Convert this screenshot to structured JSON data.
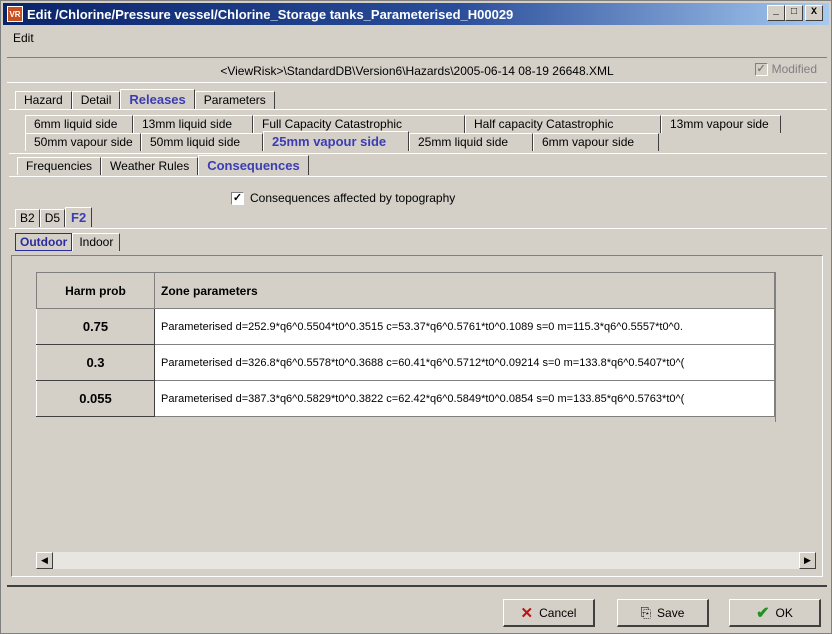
{
  "window": {
    "icon_text": "VR",
    "title": "Edit /Chlorine/Pressure vessel/Chlorine_Storage tanks_Parameterised_H00029",
    "min_glyph": "_",
    "max_glyph": "□",
    "close_glyph": "X"
  },
  "menu": {
    "edit_label": "Edit"
  },
  "pathbar": {
    "path": "<ViewRisk>\\StandardDB\\Version6\\Hazards\\2005-06-14 08-19 26648.XML",
    "modified_label": "Modified",
    "modified_checked_glyph": "✓"
  },
  "tabs_main": [
    {
      "label": "Hazard"
    },
    {
      "label": "Detail"
    },
    {
      "label": "Releases"
    },
    {
      "label": "Parameters"
    }
  ],
  "release_tabs_row1": [
    {
      "label": "6mm liquid side"
    },
    {
      "label": "13mm liquid side"
    },
    {
      "label": "Full Capacity Catastrophic"
    },
    {
      "label": "Half capacity Catastrophic"
    },
    {
      "label": "13mm vapour side"
    }
  ],
  "release_tabs_row2": [
    {
      "label": "50mm vapour side"
    },
    {
      "label": "50mm liquid side"
    },
    {
      "label": "25mm vapour side"
    },
    {
      "label": "25mm liquid side"
    },
    {
      "label": "6mm vapour side"
    }
  ],
  "sub_tabs": [
    {
      "label": "Frequencies"
    },
    {
      "label": "Weather Rules"
    },
    {
      "label": "Consequences"
    }
  ],
  "topography": {
    "label": "Consequences affected by topography",
    "checked_glyph": "✓"
  },
  "weather_tabs": [
    {
      "label": "B2"
    },
    {
      "label": "D5"
    },
    {
      "label": "F2"
    }
  ],
  "env_tabs": [
    {
      "label": "Outdoor"
    },
    {
      "label": "Indoor"
    }
  ],
  "table": {
    "headers": {
      "harm_prob": "Harm prob",
      "zone_params": "Zone parameters"
    },
    "rows": [
      {
        "harm_prob": "0.75",
        "zone": "Parameterised d=252.9*q6^0.5504*t0^0.3515 c=53.37*q6^0.5761*t0^0.1089 s=0 m=115.3*q6^0.5557*t0^0."
      },
      {
        "harm_prob": "0.3",
        "zone": "Parameterised d=326.8*q6^0.5578*t0^0.3688 c=60.41*q6^0.5712*t0^0.09214 s=0 m=133.8*q6^0.5407*t0^("
      },
      {
        "harm_prob": "0.055",
        "zone": "Parameterised d=387.3*q6^0.5829*t0^0.3822 c=62.42*q6^0.5849*t0^0.0854 s=0 m=133.85*q6^0.5763*t0^("
      }
    ]
  },
  "scroll": {
    "left_glyph": "◀",
    "right_glyph": "▶"
  },
  "buttons": {
    "cancel": {
      "label": "Cancel",
      "icon": "✕"
    },
    "save": {
      "label": "Save",
      "icon": "⎘"
    },
    "ok": {
      "label": "OK",
      "icon": "✔"
    }
  }
}
